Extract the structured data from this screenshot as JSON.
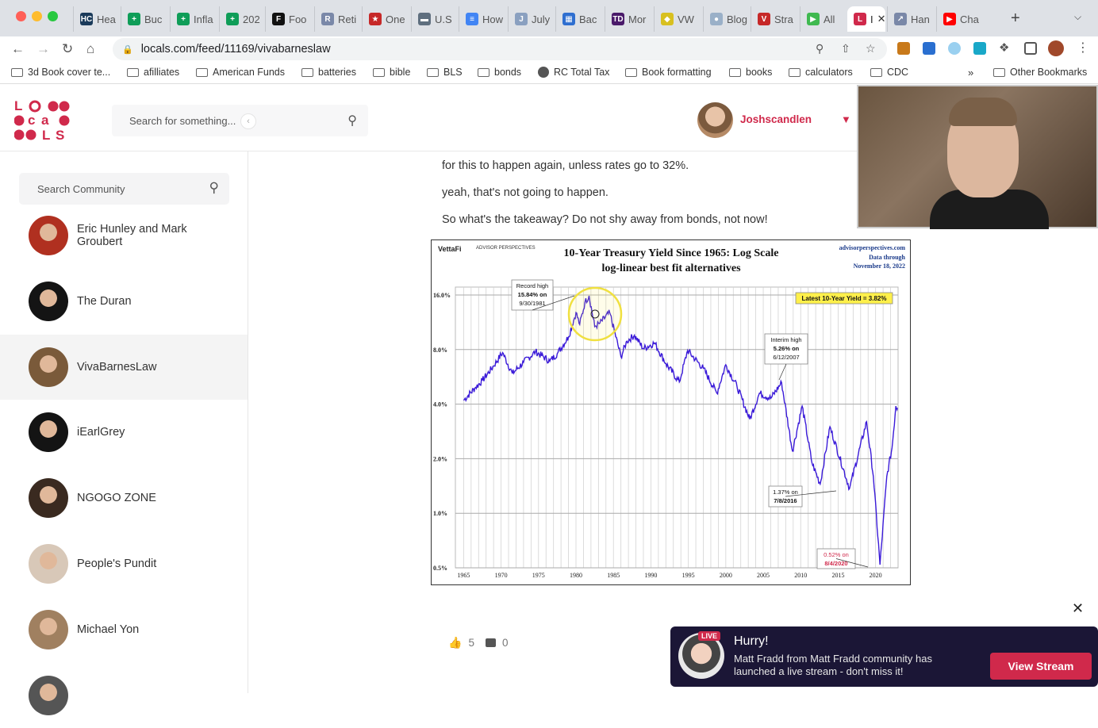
{
  "browser": {
    "tabs": [
      {
        "label": "Hea",
        "fav": "HC",
        "color": "#1a3a5a"
      },
      {
        "label": "Buc",
        "fav": "+",
        "color": "#0f9d58"
      },
      {
        "label": "Infla",
        "fav": "+",
        "color": "#0f9d58"
      },
      {
        "label": "202",
        "fav": "+",
        "color": "#0f9d58"
      },
      {
        "label": "Foo",
        "fav": "F",
        "color": "#111111"
      },
      {
        "label": "Reti",
        "fav": "R",
        "color": "#7a88a8"
      },
      {
        "label": "One",
        "fav": "★",
        "color": "#c62828"
      },
      {
        "label": "U.S",
        "fav": "▬",
        "color": "#5f6f7f"
      },
      {
        "label": "How",
        "fav": "≡",
        "color": "#4285f4"
      },
      {
        "label": "July",
        "fav": "J",
        "color": "#8aa0c0"
      },
      {
        "label": "Bac",
        "fav": "▦",
        "color": "#2f6fd0"
      },
      {
        "label": "Mor",
        "fav": "TD",
        "color": "#4a1a6a"
      },
      {
        "label": "VW",
        "fav": "◆",
        "color": "#d8c020"
      },
      {
        "label": "Blog",
        "fav": "●",
        "color": "#9ab0c8"
      },
      {
        "label": "Stra",
        "fav": "V",
        "color": "#c62828"
      },
      {
        "label": "All",
        "fav": "▶",
        "color": "#3fb950"
      },
      {
        "label": "I",
        "fav": "L",
        "color": "#d0294b",
        "active": true
      },
      {
        "label": "Han",
        "fav": "↗",
        "color": "#7a88a8"
      },
      {
        "label": "Cha",
        "fav": "▶",
        "color": "#ff0000"
      }
    ],
    "url": "locals.com/feed/11169/vivabarneslaw",
    "bookmarks": [
      "3d Book cover te...",
      "afilliates",
      "American Funds",
      "batteries",
      "bible",
      "BLS",
      "bonds",
      "RC Total Tax",
      "Book formatting",
      "books",
      "calculators",
      "CDC"
    ],
    "bookmarks_overflow": "»",
    "other_bookmarks": "Other Bookmarks"
  },
  "header": {
    "logo": "LOCALS",
    "search_placeholder": "Search for something...",
    "username": "Joshscandlen"
  },
  "sidebar": {
    "search_placeholder": "Search Community",
    "communities": [
      {
        "name": "Eric Hunley and Mark Groubert",
        "color": "#b03020"
      },
      {
        "name": "The Duran",
        "color": "#141414"
      },
      {
        "name": "VivaBarnesLaw",
        "color": "#7a5a3a",
        "selected": true
      },
      {
        "name": "iEarlGrey",
        "color": "#141414"
      },
      {
        "name": "NGOGO ZONE",
        "color": "#3a2a20"
      },
      {
        "name": "People's Pundit",
        "color": "#d8c8b8"
      },
      {
        "name": "Michael Yon",
        "color": "#a08060"
      },
      {
        "name": "",
        "color": "#555555"
      }
    ]
  },
  "post": {
    "lines": [
      "for this to happen again, unless rates go to 32%.",
      "yeah, that's not going to happen.",
      "So what's the takeaway? Do not shy away from bonds, not now!"
    ],
    "likes": "5",
    "comments": "0"
  },
  "chart_data": {
    "type": "line",
    "title": "10-Year Treasury Yield Since 1965: Log Scale",
    "subtitle": "log-linear best fit alternatives",
    "source": "advisorperspectives.com",
    "data_through_label": "Data through",
    "data_through_date": "November 18, 2022",
    "logos": [
      "VettaFi",
      "ADVISOR PERSPECTIVES"
    ],
    "latest_label": "Latest 10-Year Yield = 3.82%",
    "yscale": "log",
    "ylim": [
      0.5,
      16.0
    ],
    "yticks": [
      "0.5%",
      "1.0%",
      "2.0%",
      "4.0%",
      "8.0%",
      "16.0%"
    ],
    "yvals": [
      0.5,
      1.0,
      2.0,
      4.0,
      8.0,
      16.0
    ],
    "xlim": [
      1963.9,
      2023.0
    ],
    "xticks": [
      "1965",
      "1970",
      "1975",
      "1980",
      "1985",
      "1990",
      "1995",
      "2000",
      "2005",
      "2010",
      "2015",
      "2020"
    ],
    "grid": true,
    "series": [
      {
        "color": "#3a1ad8",
        "x": [
          1965.0,
          1966.5,
          1967.5,
          1969.0,
          1970.2,
          1971.5,
          1973.0,
          1974.6,
          1976.5,
          1977.5,
          1979.0,
          1980.0,
          1980.5,
          1981.2,
          1981.75,
          1982.5,
          1983.2,
          1984.5,
          1986.0,
          1986.8,
          1987.8,
          1989.0,
          1990.5,
          1992.0,
          1993.8,
          1994.9,
          1997.0,
          1998.8,
          2000.0,
          2001.5,
          2003.2,
          2004.5,
          2006.0,
          2007.45,
          2008.9,
          2010.2,
          2011.5,
          2012.6,
          2013.9,
          2016.52,
          2018.8,
          2019.7,
          2020.59,
          2021.5,
          2022.2,
          2022.7,
          2022.9
        ],
        "y": [
          4.2,
          4.9,
          5.4,
          6.5,
          7.7,
          5.9,
          6.8,
          7.8,
          6.9,
          7.6,
          9.4,
          12.8,
          11.0,
          14.6,
          15.84,
          10.7,
          11.2,
          12.8,
          7.3,
          8.9,
          9.6,
          8.1,
          8.7,
          6.7,
          5.3,
          7.9,
          6.3,
          4.6,
          6.6,
          5.0,
          3.3,
          4.6,
          4.3,
          5.26,
          2.2,
          3.9,
          1.9,
          1.45,
          3.0,
          1.37,
          3.2,
          1.6,
          0.52,
          1.6,
          2.3,
          3.9,
          3.82
        ]
      }
    ],
    "annotations": [
      {
        "lines": [
          "Record high",
          "15.84% on",
          "9/30/1981"
        ]
      },
      {
        "lines": [
          "Interim high",
          "5.26% on",
          "6/12/2007"
        ]
      },
      {
        "lines": [
          "1.37% on",
          "7/8/2016"
        ]
      },
      {
        "lines": [
          "0.52% on",
          "8/4/2020"
        ],
        "color": "#d0294b"
      }
    ]
  },
  "toast": {
    "badge": "LIVE",
    "title": "Hurry!",
    "message": "Matt Fradd from Matt Fradd community has launched a live stream - don't miss it!",
    "button": "View Stream"
  }
}
